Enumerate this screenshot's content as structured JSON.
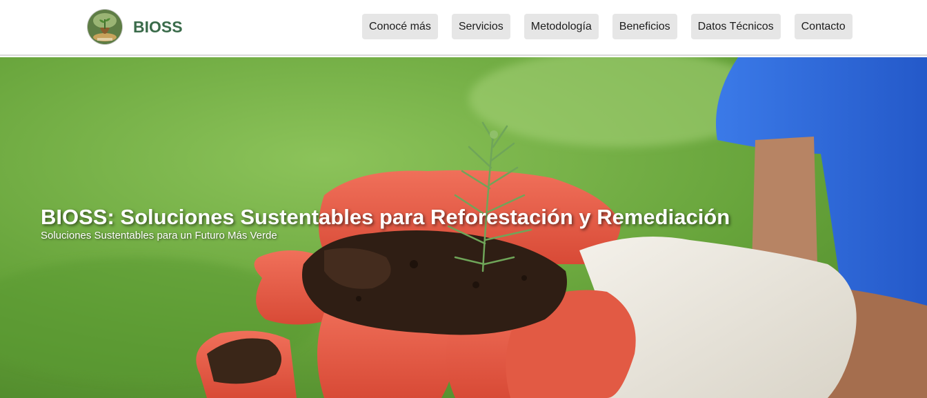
{
  "header": {
    "brand": "BIOSS",
    "logo_icon": "sprout-globe-logo",
    "nav": [
      {
        "label": "Conocé más"
      },
      {
        "label": "Servicios"
      },
      {
        "label": "Metodología"
      },
      {
        "label": "Beneficios"
      },
      {
        "label": "Datos Técnicos"
      },
      {
        "label": "Contacto"
      }
    ]
  },
  "hero": {
    "title": "BIOSS: Soluciones Sustentables para Reforestación y Remediación",
    "subtitle": "Soluciones Sustentables para un Futuro Más Verde",
    "image": "gloved-hands-holding-soil-and-seedling"
  },
  "colors": {
    "brand_text": "#3a6b4a",
    "nav_button_bg": "#e6e6e6",
    "hero_green": "#6fa83f",
    "glove_red": "#e2553f",
    "shirt_blue": "#2d6be0"
  }
}
